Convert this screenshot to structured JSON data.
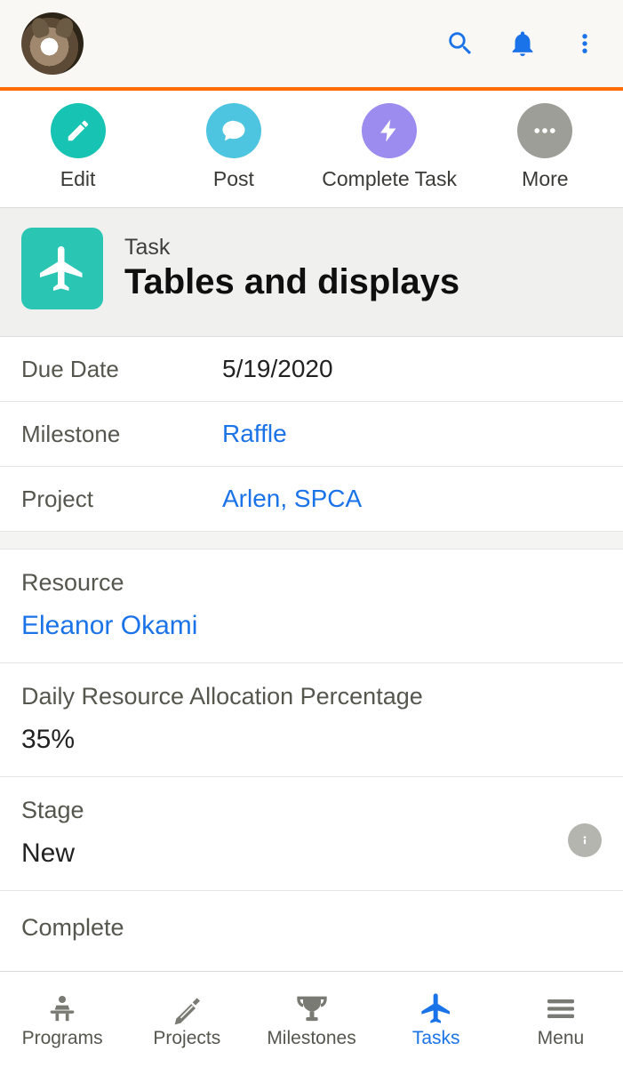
{
  "header": {
    "icons": {
      "search": "search-icon",
      "bell": "bell-icon",
      "more": "vertical-dots-icon"
    }
  },
  "actions": {
    "edit": "Edit",
    "post": "Post",
    "complete_task": "Complete Task",
    "more": "More"
  },
  "record": {
    "type_label": "Task",
    "title": "Tables and displays",
    "icon": "airplane-icon"
  },
  "fields": {
    "due_date": {
      "label": "Due Date",
      "value": "5/19/2020"
    },
    "milestone": {
      "label": "Milestone",
      "value": "Raffle"
    },
    "project": {
      "label": "Project",
      "value": "Arlen, SPCA"
    },
    "resource": {
      "label": "Resource",
      "value": "Eleanor Okami"
    },
    "allocation": {
      "label": "Daily Resource Allocation Percentage",
      "value": "35%"
    },
    "stage": {
      "label": "Stage",
      "value": "New"
    },
    "complete": {
      "label": "Complete"
    }
  },
  "nav": {
    "programs": "Programs",
    "projects": "Projects",
    "milestones": "Milestones",
    "tasks": "Tasks",
    "menu": "Menu"
  }
}
